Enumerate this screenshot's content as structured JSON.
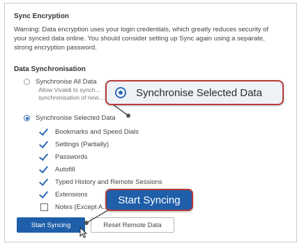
{
  "sync_encryption": {
    "title": "Sync Encryption",
    "warning": "Warning: Data encryption uses your login credentials, which greatly reduces security of your synced data online. You should consider setting up Sync again using a separate, strong encryption password."
  },
  "data_sync": {
    "title": "Data Synchronisation",
    "option_all": {
      "label": "Synchronise All Data",
      "description": "Allow Vivaldi to synch... synchronisation of new...",
      "selected": false
    },
    "option_selected": {
      "label": "Synchronise Selected Data",
      "selected": true
    },
    "items": [
      {
        "label": "Bookmarks and Speed Dials",
        "checked": true
      },
      {
        "label": "Settings (Partially)",
        "checked": true
      },
      {
        "label": "Passwords",
        "checked": true
      },
      {
        "label": "Autofill",
        "checked": true
      },
      {
        "label": "Typed History and Remote Sessions",
        "checked": true
      },
      {
        "label": "Extensions",
        "checked": true
      },
      {
        "label": "Notes (Except A...",
        "checked": false
      }
    ]
  },
  "buttons": {
    "start_syncing": "Start Syncing",
    "reset_remote_data": "Reset Remote Data"
  },
  "callouts": {
    "selected_data": "Synchronise Selected Data",
    "start_syncing": "Start Syncing"
  },
  "colors": {
    "accent": "#1f5faa",
    "callout_border": "#b73a3a",
    "checkbox": "#2a6ab7"
  }
}
